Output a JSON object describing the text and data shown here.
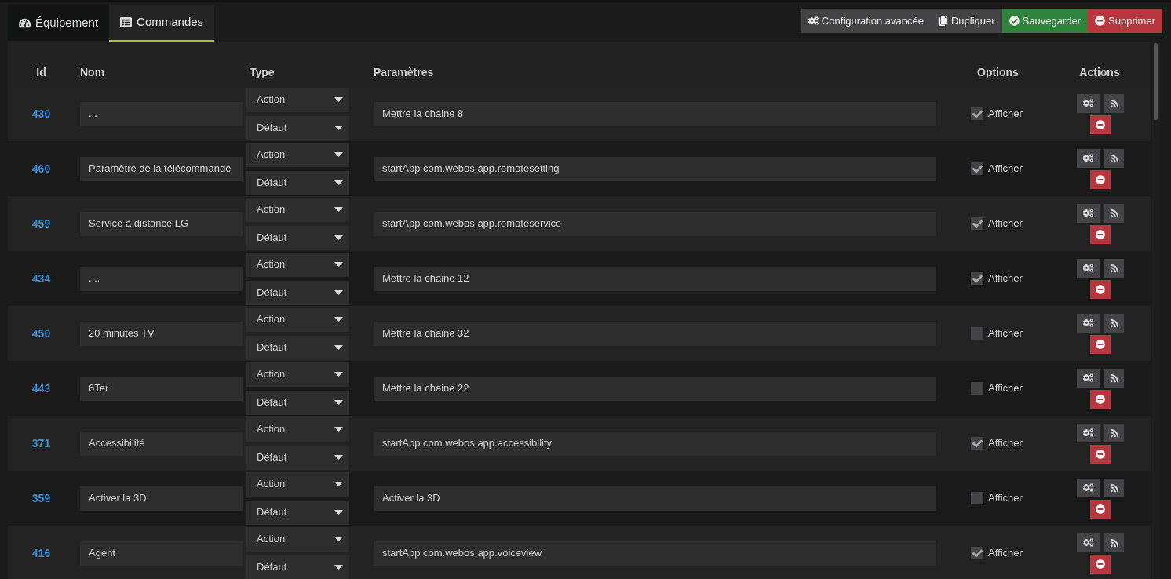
{
  "tabs": [
    {
      "label": "Équipement",
      "selected": false
    },
    {
      "label": "Commandes",
      "selected": true
    }
  ],
  "toolbar": [
    {
      "label": "Configuration avancée",
      "kind": "neutral"
    },
    {
      "label": "Dupliquer",
      "kind": "neutral"
    },
    {
      "label": "Sauvegarder",
      "kind": "success"
    },
    {
      "label": "Supprimer",
      "kind": "danger"
    }
  ],
  "table": {
    "columns": [
      "Id",
      "Nom",
      "Type",
      "Paramètres",
      "Options",
      "Actions"
    ],
    "rows": [
      {
        "id": "430",
        "name": "...",
        "type": "Action",
        "subtype": "Défaut",
        "param": "Mettre la chaine 8",
        "option": "Afficher",
        "checked": true
      },
      {
        "id": "460",
        "name": "Paramètre de la télécommande",
        "type": "Action",
        "subtype": "Défaut",
        "param": "startApp com.webos.app.remotesetting",
        "option": "Afficher",
        "checked": true
      },
      {
        "id": "459",
        "name": "Service à distance LG",
        "type": "Action",
        "subtype": "Défaut",
        "param": "startApp com.webos.app.remoteservice",
        "option": "Afficher",
        "checked": true
      },
      {
        "id": "434",
        "name": "....",
        "type": "Action",
        "subtype": "Défaut",
        "param": "Mettre la chaine 12",
        "option": "Afficher",
        "checked": true
      },
      {
        "id": "450",
        "name": "20 minutes TV",
        "type": "Action",
        "subtype": "Défaut",
        "param": "Mettre la chaine 32",
        "option": "Afficher",
        "checked": false
      },
      {
        "id": "443",
        "name": "6Ter",
        "type": "Action",
        "subtype": "Défaut",
        "param": "Mettre la chaine 22",
        "option": "Afficher",
        "checked": false
      },
      {
        "id": "371",
        "name": "Accessibilité",
        "type": "Action",
        "subtype": "Défaut",
        "param": "startApp com.webos.app.accessibility",
        "option": "Afficher",
        "checked": true
      },
      {
        "id": "359",
        "name": "Activer la 3D",
        "type": "Action",
        "subtype": "Défaut",
        "param": "Activer la 3D",
        "option": "Afficher",
        "checked": false
      },
      {
        "id": "416",
        "name": "Agent",
        "type": "Action",
        "subtype": "Défaut",
        "param": "startApp com.webos.app.voiceview",
        "option": "Afficher",
        "checked": true
      }
    ]
  }
}
